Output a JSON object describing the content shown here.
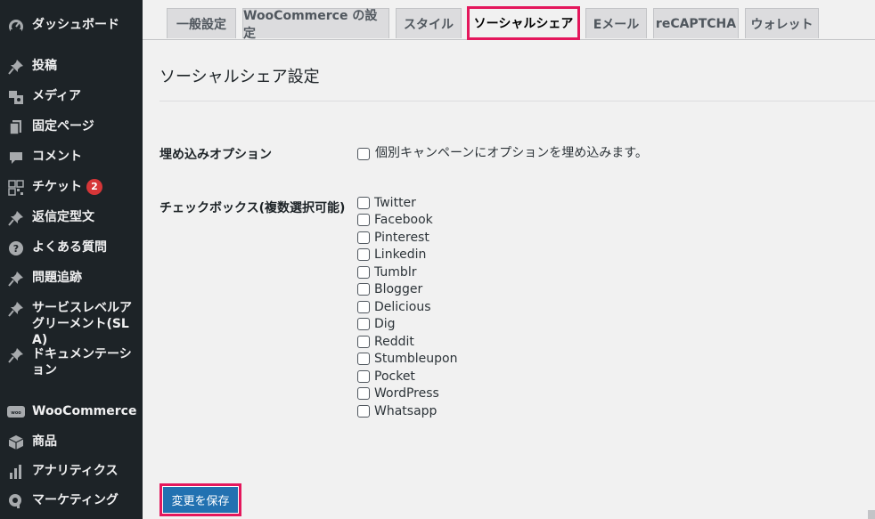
{
  "sidebar": {
    "items": [
      {
        "label": "ダッシュボード",
        "icon": "dashboard-icon"
      },
      {
        "label": "投稿",
        "icon": "pin-icon"
      },
      {
        "label": "メディア",
        "icon": "media-icon"
      },
      {
        "label": "固定ページ",
        "icon": "page-icon"
      },
      {
        "label": "コメント",
        "icon": "comment-icon"
      },
      {
        "label": "チケット",
        "icon": "grid-icon",
        "badge": "2"
      },
      {
        "label": "返信定型文",
        "icon": "pin-icon"
      },
      {
        "label": "よくある質問",
        "icon": "help-icon"
      },
      {
        "label": "問題追跡",
        "icon": "pin-icon"
      },
      {
        "label": "サービスレベルアグリーメント(SLA)",
        "icon": "pin-icon"
      },
      {
        "label": "ドキュメンテーション",
        "icon": "pin-icon"
      },
      {
        "label": "WooCommerce",
        "icon": "woo-icon"
      },
      {
        "label": "商品",
        "icon": "box-icon"
      },
      {
        "label": "アナリティクス",
        "icon": "bar-chart-icon"
      },
      {
        "label": "マーケティング",
        "icon": "megaphone-icon"
      }
    ]
  },
  "tabs": [
    {
      "label": "一般設定",
      "active": false
    },
    {
      "label": "WooCommerce の設定",
      "active": false
    },
    {
      "label": "スタイル",
      "active": false
    },
    {
      "label": "ソーシャルシェア",
      "active": true
    },
    {
      "label": "Eメール",
      "active": false
    },
    {
      "label": "reCAPTCHA",
      "active": false
    },
    {
      "label": "ウォレット",
      "active": false
    }
  ],
  "page": {
    "title": "ソーシャルシェア設定",
    "embed_label": "埋め込みオプション",
    "embed_checkbox_text": "個別キャンペーンにオプションを埋め込みます。",
    "checkbox_label": "チェックボックス(複数選択可能)",
    "checkboxes": [
      "Twitter",
      "Facebook",
      "Pinterest",
      "Linkedin",
      "Tumblr",
      "Blogger",
      "Delicious",
      "Dig",
      "Reddit",
      "Stumbleupon",
      "Pocket",
      "WordPress",
      "Whatsapp"
    ],
    "save_label": "変更を保存"
  },
  "colors": {
    "sidebar_bg": "#1d2327",
    "highlight": "#e4175c",
    "primary_button": "#2271b1",
    "badge": "#d63638"
  }
}
